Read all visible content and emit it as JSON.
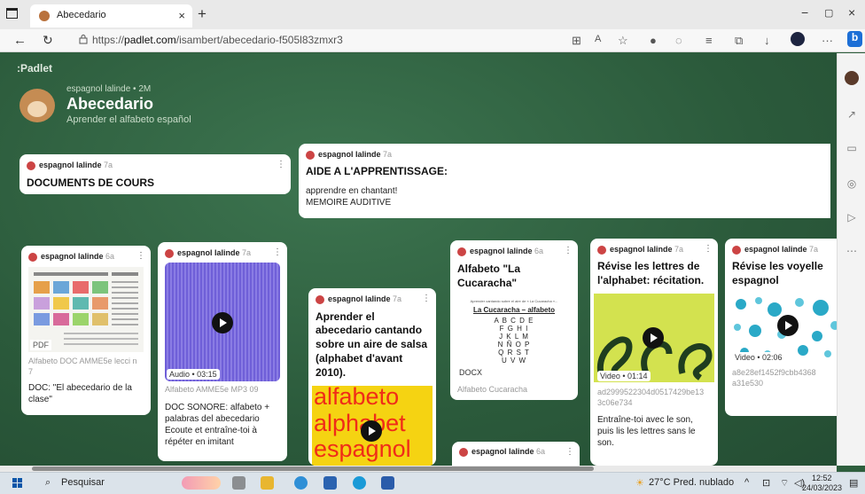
{
  "browser": {
    "tab_title": "Abecedario",
    "tab_close": "×",
    "new_tab": "+",
    "url_prefix": "https://",
    "url_domain": "padlet.com",
    "url_path": "/isambert/abecedario-f505l83zmxr3",
    "min": "−",
    "max": "▢",
    "close": "×",
    "more": "···"
  },
  "padlet": {
    "logo": ":Padlet",
    "author_line": "espagnol lalinde • 2M",
    "title": "Abecedario",
    "subtitle": "Aprender el alfabeto español"
  },
  "cards": {
    "docs": {
      "author": "espagnol lalinde",
      "age": "7a",
      "title": "DOCUMENTS DE COURS"
    },
    "aide": {
      "author": "espagnol lalinde",
      "age": "7a",
      "title": "AIDE A L'APPRENTISSAGE:",
      "line1": "apprendre en chantant!",
      "line2": "MEMOIRE AUDITIVE"
    },
    "c1": {
      "author": "espagnol lalinde",
      "age": "6a",
      "badge": "PDF",
      "file": "Alfabeto DOC AMME5e lecci n",
      "file2": "7",
      "text1": "DOC: \"El abecedario de la",
      "text2": "clase\""
    },
    "c2": {
      "author": "espagnol lalinde",
      "age": "7a",
      "badge": "Audio • 03:15",
      "file": "Alfabeto AMME5e MP3 09",
      "t1": "DOC SONORE: alfabeto +",
      "t2": "palabras del abecedario",
      "t3": "Ecoute et entraîne-toi à",
      "t4": "répéter en imitant"
    },
    "c3": {
      "author": "espagnol lalinde",
      "age": "7a",
      "t1": "Aprender el",
      "t2": "abecedario cantando",
      "t3": "sobre un aire de salsa",
      "t4": "(alphabet d'avant",
      "t5": "2010).",
      "img1": "alfabeto",
      "img2": "alphabet",
      "img3": "espagnol"
    },
    "c4": {
      "author": "espagnol lalinde",
      "age": "6a",
      "t1": "Alfabeto \"La",
      "t2": "Cucaracha\"",
      "doc_small": "Aprender cantando sobre el aire de « La Cucaracha »...",
      "doc_title": "La Cucaracha – alfabeto",
      "l1": "A B C D E",
      "l2": "F G H I",
      "l3": "J K L M",
      "l4": "N Ñ O P",
      "l5": "Q R S T",
      "l6": "U V W",
      "badge": "DOCX",
      "file": "Alfabeto Cucaracha"
    },
    "c5": {
      "author": "espagnol lalinde",
      "age": "6a"
    },
    "c6": {
      "author": "espagnol lalinde",
      "age": "7a",
      "t1": "Révise les lettres de",
      "t2": "l'alphabet: récitation.",
      "badge": "Video • 01:14",
      "hash1": "ad2999522304d0517429be13",
      "hash2": "3c06e734",
      "d1": "Entraîne-toi avec le son,",
      "d2": "puis lis les lettres sans le",
      "d3": "son."
    },
    "c7": {
      "author": "espagnol lalinde",
      "age": "7a",
      "t1": "Révise les voyelle",
      "t2": "espagnol",
      "badge": "Video • 02:06",
      "hash1": "a8e28ef1452f9cbb4368",
      "hash2": "a31e530"
    }
  },
  "taskbar": {
    "search": "Pesquisar",
    "weather": "27°C Pred. nublado",
    "time": "12:52",
    "date": "24/03/2023"
  },
  "colors": {
    "background": "#2e5e3d",
    "audio": "#6f5fd8",
    "video_green": "#d3e24f",
    "yellow": "#f5d312",
    "red_text": "#f02c18"
  }
}
